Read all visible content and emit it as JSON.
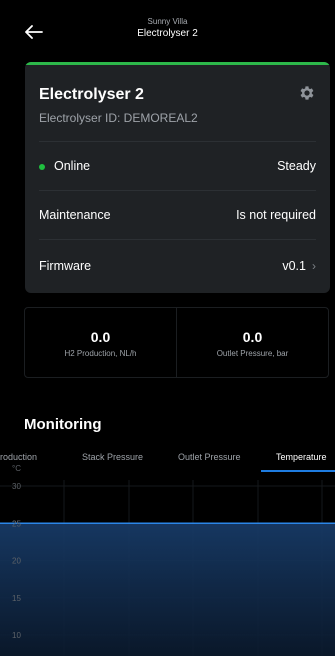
{
  "header": {
    "site": "Sunny Villa",
    "title": "Electrolyser 2",
    "back_icon": "arrow-left-icon"
  },
  "device": {
    "name": "Electrolyser 2",
    "type_id": "Electrolyser  ID: DEMOREAL2",
    "settings_icon": "gear-icon",
    "accent_color": "#2db84a",
    "rows": {
      "status_label": "Online",
      "status_value": "Steady",
      "status_color": "#1fbf3f",
      "maintenance_label": "Maintenance",
      "maintenance_value": "Is not required",
      "firmware_label": "Firmware",
      "firmware_value": "v0.1"
    }
  },
  "metrics": [
    {
      "value": "0.0",
      "label": "H2 Production, NL/h"
    },
    {
      "value": "0.0",
      "label": "Outlet Pressure, bar"
    }
  ],
  "monitoring": {
    "title": "Monitoring",
    "tabs": [
      "roduction",
      "Stack Pressure",
      "Outlet Pressure",
      "Temperature"
    ],
    "active_tab": "Temperature",
    "accent_color": "#1e7ce0"
  },
  "chart_data": {
    "type": "area",
    "ylabel": "°C",
    "yticks": [
      "30",
      "25",
      "20",
      "15",
      "10"
    ],
    "ylim": [
      10,
      30
    ],
    "series": [
      {
        "values": [
          25,
          25,
          25,
          25,
          25,
          25
        ]
      }
    ],
    "grid": true
  }
}
